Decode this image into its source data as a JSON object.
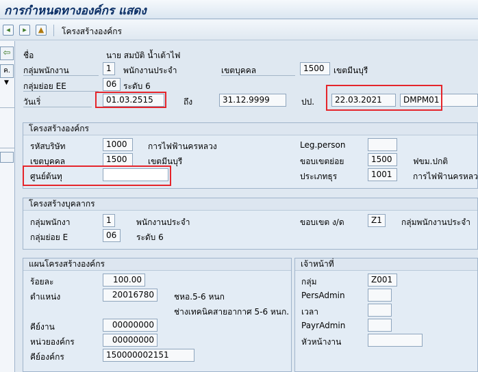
{
  "title": "การกำหนดทางองค์กร แสดง",
  "toolbar": {
    "icons": [
      "back-page-icon",
      "forward-page-icon",
      "mountain-image-icon"
    ],
    "structure_button": "โครงสร้างองค์กร"
  },
  "left_pane": {
    "back_icon": "back-arrow-icon",
    "btn2": "ค.",
    "arrow": "▼"
  },
  "header": {
    "name_label": "ชื่อ",
    "name_value": "นาย สมบัติ น้ำเต้าไฟ",
    "emp_group_label": "กลุ่มพนักงาน",
    "emp_group_code": "1",
    "emp_group_text": "พนักงานประจำ",
    "personnel_area_label": "เขตบุคคล",
    "personnel_area_code": "1500",
    "personnel_area_text": "เขตมีนบุรี",
    "emp_subgroup_label": "กลุ่มย่อย EE",
    "emp_subgroup_code": "06",
    "emp_subgroup_text": "ระดับ 6",
    "start_label": "วันเริ่",
    "start_date": "01.03.2515",
    "to_label": "ถึง",
    "end_date": "31.12.9999",
    "changed_label": "ปป.",
    "changed_date": "22.03.2021",
    "changed_by": "DMPM01"
  },
  "org_structure": {
    "title": "โครงสร้างองค์กร",
    "company_code_label": "รหัสบริษัท",
    "company_code": "1000",
    "company_text": "การไฟฟ้านครหลวง",
    "legal_person_label": "Leg.person",
    "legal_person_value": "",
    "personnel_area_label": "เขตบุคคล",
    "personnel_area_code": "1500",
    "personnel_area_text": "เขตมีนบุรี",
    "subarea_label": "ขอบเขตย่อย",
    "subarea_code": "1500",
    "subarea_text": "ฟขม.ปกติ",
    "cost_center_label": "ศูนย์ต้นทุ",
    "cost_center_value": "",
    "business_area_label": "ประเภทธุร",
    "business_area_code": "1001",
    "business_area_text": "การไฟฟ้านครหลวง"
  },
  "personnel_structure": {
    "title": "โครงสร้างบุคลากร",
    "emp_group_label": "กลุ่มพนักงา",
    "emp_group_code": "1",
    "emp_group_text": "พนักงานประจำ",
    "payroll_area_label": "ขอบเขต ง/ด",
    "payroll_area_code": "Z1",
    "payroll_area_text": "กลุ่มพนักงานประจำ",
    "emp_subgroup_label": "กลุ่มย่อย E",
    "emp_subgroup_code": "06",
    "emp_subgroup_text": "ระดับ 6"
  },
  "org_plan": {
    "title": "แผนโครงสร้างองค์กร",
    "percent_label": "ร้อยละ",
    "percent_value": "100.00",
    "position_label": "ตำแหน่ง",
    "position_code": "20016780",
    "position_text1": "ชหอ.5-6 หนก",
    "position_text2": "ช่างเทคนิคสายอากาศ 5-6 หนก.",
    "job_label": "คีย์งาน",
    "job_code": "00000000",
    "org_unit_label": "หน่วยองค์กร",
    "org_unit_code": "00000000",
    "org_key_label": "คีย์องค์กร",
    "org_key_value": "150000002151"
  },
  "responsible": {
    "title": "เจ้าหน้าที่",
    "group_label": "กลุ่ม",
    "group_value": "Z001",
    "pers_admin_label": "PersAdmin",
    "pers_admin_value": "",
    "time_label": "เวลา",
    "time_value": "",
    "payr_admin_label": "PayrAdmin",
    "payr_admin_value": "",
    "supervisor_label": "หัวหน้างาน",
    "supervisor_value": ""
  },
  "colors": {
    "background": "#dfe8f1",
    "highlight": "#e5242a",
    "title": "#0b2f66"
  }
}
